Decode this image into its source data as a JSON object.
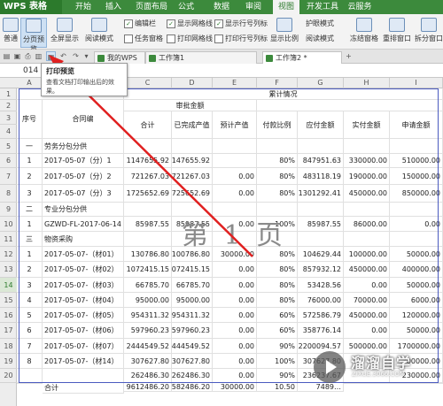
{
  "app": {
    "title": "WPS 表格"
  },
  "menu": [
    "开始",
    "插入",
    "页面布局",
    "公式",
    "数据",
    "审阅",
    "视图",
    "开发工具",
    "云服务"
  ],
  "menu_active_index": 6,
  "ribbon": {
    "normal": "普通",
    "page_break_preview": "分页预览",
    "full_screen": "全屏显示",
    "reading_mode": "阅读模式",
    "edit_bar": "编辑栏",
    "task_pane": "任务窗格",
    "show_gridlines": "显示网格线",
    "print_gridlines": "打印网格线",
    "show_row_col_headers": "显示行号列标",
    "print_row_col_headers": "打印行号列标",
    "display_ratio": "显示比例",
    "eye_protection": "护眼模式",
    "reading_mode_2": "阅读模式",
    "freeze_panes": "冻结窗格",
    "rearrange_windows": "重排窗口",
    "split_window": "拆分窗口"
  },
  "doc_tabs": [
    "我的WPS",
    "工作簿1",
    "工作簿2 *"
  ],
  "name_box": "014",
  "tooltip": {
    "title": "打印预览",
    "body": "查看文档打印输出后的效果。"
  },
  "columns": [
    "A",
    "B",
    "C",
    "D",
    "E",
    "F",
    "G",
    "H",
    "I"
  ],
  "rows": [
    "1",
    "2",
    "3",
    "4",
    "5",
    "6",
    "7",
    "8",
    "9",
    "10",
    "11",
    "12",
    "13",
    "14",
    "15",
    "16",
    "17",
    "18",
    "19",
    "20"
  ],
  "selected_row": "14",
  "sheet": {
    "header": {
      "seq": "序号",
      "contract": "合同编",
      "cumulative": "累计情况",
      "audit_amount": "审批金额",
      "total": "合计",
      "completed_value": "已完成产值",
      "expected_value": "预计产值",
      "payment_ratio": "付款比例",
      "payable": "应付金额",
      "paid": "实付金额",
      "requested": "申请金额"
    },
    "row_values": [
      {
        "a": "一",
        "b": "劳务分包分供",
        "c": "",
        "d": "",
        "e": "",
        "f": "",
        "g": "",
        "h": "",
        "i": ""
      },
      {
        "a": "1",
        "b": "2017-05-07（分）1",
        "c": "1147655.92",
        "d": "1147655.92",
        "e": "",
        "f": "80%",
        "g": "847951.63",
        "h": "330000.00",
        "i": "510000.00"
      },
      {
        "a": "2",
        "b": "2017-05-07（分）2",
        "c": "721267.03",
        "d": "721267.03",
        "e": "0.00",
        "f": "80%",
        "g": "483118.19",
        "h": "190000.00",
        "i": "150000.00"
      },
      {
        "a": "3",
        "b": "2017-05-07（分）3",
        "c": "1725652.69",
        "d": "1725652.69",
        "e": "0.00",
        "f": "80%",
        "g": "1301292.41",
        "h": "450000.00",
        "i": "850000.00"
      },
      {
        "a": "二",
        "b": "专业分包分供",
        "c": "",
        "d": "",
        "e": "",
        "f": "",
        "g": "",
        "h": "",
        "i": ""
      },
      {
        "a": "1",
        "b": "GZWD-FL-2017-06-14",
        "c": "85987.55",
        "d": "85987.55",
        "e": "0.00",
        "f": "100%",
        "g": "85987.55",
        "h": "86000.00",
        "i": "0.00"
      },
      {
        "a": "三",
        "b": "物资采购",
        "c": "",
        "d": "",
        "e": "",
        "f": "",
        "g": "",
        "h": "",
        "i": ""
      },
      {
        "a": "1",
        "b": "2017-05-07-（材01）",
        "c": "130786.80",
        "d": "100786.80",
        "e": "30000.00",
        "f": "80%",
        "g": "104629.44",
        "h": "100000.00",
        "i": "50000.00"
      },
      {
        "a": "2",
        "b": "2017-05-07-（材02）",
        "c": "1072415.15",
        "d": "1072415.15",
        "e": "0.00",
        "f": "80%",
        "g": "857932.12",
        "h": "450000.00",
        "i": "400000.00"
      },
      {
        "a": "3",
        "b": "2017-05-07-（材03）",
        "c": "66785.70",
        "d": "66785.70",
        "e": "0.00",
        "f": "80%",
        "g": "53428.56",
        "h": "0.00",
        "i": "50000.00"
      },
      {
        "a": "4",
        "b": "2017-05-07-（材04）",
        "c": "95000.00",
        "d": "95000.00",
        "e": "0.00",
        "f": "80%",
        "g": "76000.00",
        "h": "70000.00",
        "i": "6000.00"
      },
      {
        "a": "5",
        "b": "2017-05-07-（材05）",
        "c": "954311.32",
        "d": "954311.32",
        "e": "0.00",
        "f": "60%",
        "g": "572586.79",
        "h": "450000.00",
        "i": "120000.00"
      },
      {
        "a": "6",
        "b": "2017-05-07-（材06）",
        "c": "597960.23",
        "d": "597960.23",
        "e": "0.00",
        "f": "60%",
        "g": "358776.14",
        "h": "0.00",
        "i": "50000.00"
      },
      {
        "a": "7",
        "b": "2017-05-07-（材07）",
        "c": "2444549.52",
        "d": "2444549.52",
        "e": "0.00",
        "f": "90%",
        "g": "2200094.57",
        "h": "500000.00",
        "i": "1700000.00"
      },
      {
        "a": "8",
        "b": "2017-05-07-（材14）",
        "c": "307627.80",
        "d": "307627.80",
        "e": "0.00",
        "f": "100%",
        "g": "307627.80",
        "h": "",
        "i": "300000.00"
      },
      {
        "a": "",
        "b": "",
        "c": "262486.30",
        "d": "262486.30",
        "e": "0.00",
        "f": "90%",
        "g": "236237.67",
        "h": "",
        "i": "230000.00"
      },
      {
        "a": "",
        "b": "合计",
        "c": "9612486.20",
        "d": "9582486.20",
        "e": "30000.00",
        "f": "10.50",
        "g": "7489…",
        "h": "",
        "i": ""
      }
    ]
  },
  "page_watermark": "第 1 页",
  "logo": {
    "name": "溜溜自学",
    "sub": "ZIXUE.3066.COM"
  }
}
